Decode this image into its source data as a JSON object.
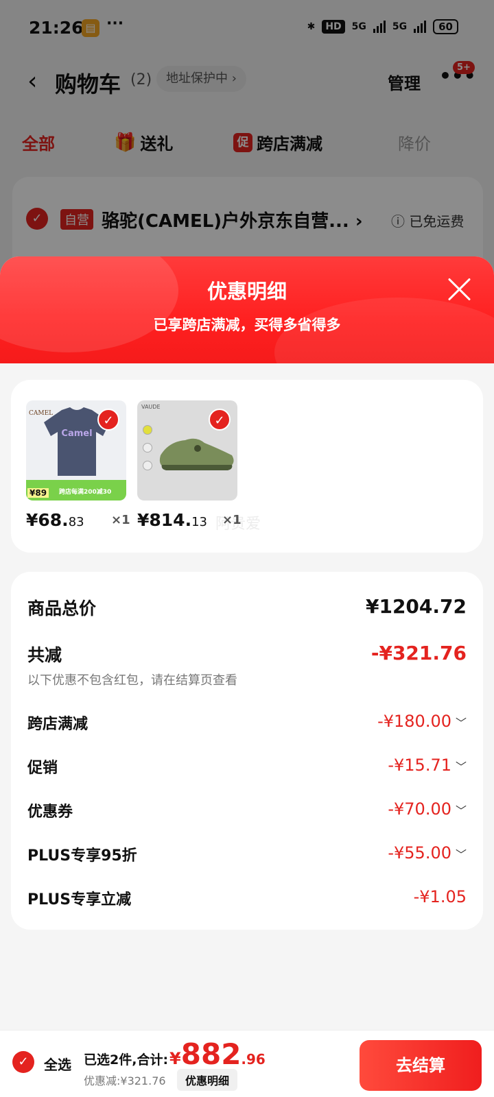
{
  "status_bar": {
    "time": "21:26",
    "app_icon": "book-icon",
    "more": "···",
    "network": "HD",
    "signal_1": "5G",
    "signal_2": "5G",
    "battery": "60"
  },
  "nav": {
    "title": "购物车",
    "count": "(2)",
    "address_pill": "地址保护中 ›",
    "manage": "管理",
    "more": "•••",
    "badge": "5+"
  },
  "tabs": [
    {
      "label": "全部"
    },
    {
      "label": "送礼",
      "icon": "gift-icon"
    },
    {
      "label": "跨店满减",
      "icon_text": "促"
    },
    {
      "label": "降价"
    }
  ],
  "background_card": {
    "tag": "自营",
    "shop_name": "骆驼(CAMEL)户外京东自营...",
    "arrow": "›",
    "shipping": "ⓘ 已免运费"
  },
  "modal": {
    "title": "优惠明细",
    "subtitle": "已享跨店满减，买得多省得多",
    "products": [
      {
        "brand": "CAMEL",
        "image_text": "Camel",
        "banner_label": "¥89",
        "banner_text": "跨店每满200减30",
        "price_int": "¥68.",
        "price_dec": "83",
        "qty": "×1"
      },
      {
        "brand": "VAUDE",
        "price_int": "¥814.",
        "price_dec": "13",
        "qty": "×1"
      }
    ],
    "watermark": "阿贵爱",
    "total": {
      "label": "商品总价",
      "value": "¥1204.72"
    },
    "reduction": {
      "label": "共减",
      "value": "-¥321.76",
      "note": "以下优惠不包含红包，请在结算页查看"
    },
    "items": [
      {
        "label": "跨店满减",
        "value": "-¥180.00",
        "chevron": "﹀"
      },
      {
        "label": "促销",
        "value": "-¥15.71",
        "chevron": "﹀"
      },
      {
        "label": "优惠券",
        "value": "-¥70.00",
        "chevron": "﹀"
      },
      {
        "label": "PLUS专享95折",
        "value": "-¥55.00",
        "chevron": "﹀"
      },
      {
        "label": "PLUS专享立减",
        "value": "-¥1.05",
        "chevron": ""
      }
    ]
  },
  "bottom_bar": {
    "select_all": "全选",
    "summary_prefix": "已选2件,合计:",
    "currency": "¥",
    "total_int": "882",
    "total_dec": ".96",
    "discount": "优惠减:¥321.76",
    "detail_button": "优惠明细",
    "checkout": "去结算"
  },
  "colors": {
    "accent": "#e4231f",
    "modal_header": "#ff2a2a"
  }
}
